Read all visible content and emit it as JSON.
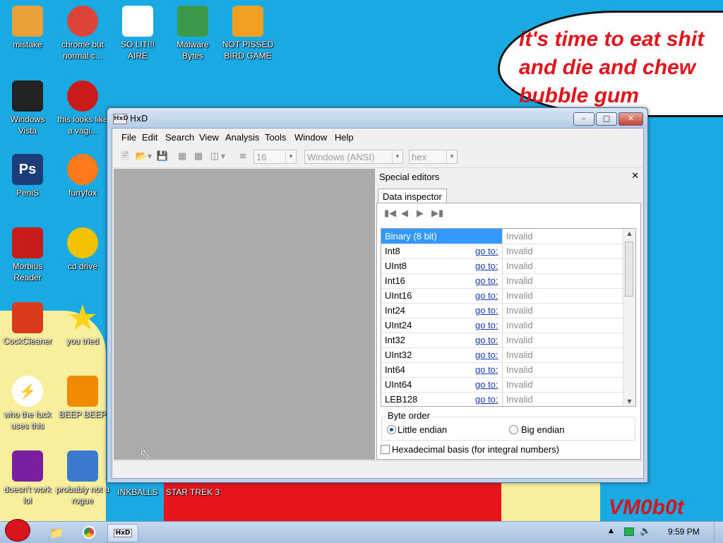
{
  "desktop": {
    "bubble_text": "it's time to eat shit\nand die and chew\nbubble gum",
    "signature": "VM0b0t",
    "icons": [
      {
        "label": "mistake",
        "icon": "folder-computer-icon",
        "color": "#e8a13a"
      },
      {
        "label": "chrome but normal c...",
        "icon": "chrome-icon",
        "color": "#db4437"
      },
      {
        "label": "SO LIT!!! AIRE",
        "icon": "solitaire-cards-icon",
        "color": "#ffffff"
      },
      {
        "label": "Malware Bytes",
        "icon": "shield-check-icon",
        "color": "#3a9a4a"
      },
      {
        "label": "NOT PISSED BIRD GAME",
        "icon": "green-pig-icon",
        "color": "#f0a020"
      },
      {
        "label": "Windows Vista",
        "icon": "trash-bin-icon",
        "color": "#222222"
      },
      {
        "label": "this looks like a vagi...",
        "icon": "opera-icon",
        "color": "#cc1b1b"
      },
      {
        "label": "PeniS",
        "icon": "photoshop-icon",
        "color": "#1c3d7a"
      },
      {
        "label": "furryfox",
        "icon": "firefox-icon",
        "color": "#ff7a1a"
      },
      {
        "label": "Morbius Reader",
        "icon": "acrobat-reader-icon",
        "color": "#c81b1b"
      },
      {
        "label": "cd drive",
        "icon": "cd-icon",
        "color": "#f2c200"
      },
      {
        "label": "CockCleaner",
        "icon": "ccleaner-icon",
        "color": "#d93a1a"
      },
      {
        "label": "you tried",
        "icon": "gold-star-icon",
        "color": "#ffd21a"
      },
      {
        "label": "who the fuck uses this",
        "icon": "lightning-icon",
        "color": "#e65a16"
      },
      {
        "label": "BEEP BEEP",
        "icon": "vlc-cone-icon",
        "color": "#f08a00"
      },
      {
        "label": "doesn't work lol",
        "icon": "yahoo-messenger-icon",
        "color": "#7a1fa0"
      },
      {
        "label": "probably not a rogue",
        "icon": "settings-monitor-icon",
        "color": "#3a7ad0"
      },
      {
        "label": "INKBALLS",
        "icon": "",
        "color": ""
      },
      {
        "label": "STAR TREK 3",
        "icon": "",
        "color": ""
      }
    ]
  },
  "window": {
    "title": "HxD",
    "menu": [
      "File",
      "Edit",
      "Search",
      "View",
      "Analysis",
      "Tools",
      "Window",
      "Help"
    ],
    "toolbar": {
      "bytes_per_row": "16",
      "charset": "Windows (ANSI)",
      "offset_base": "hex"
    },
    "special_editors": {
      "title": "Special editors",
      "tab": "Data inspector",
      "rows": [
        {
          "type": "Binary (8 bit)",
          "goto": "",
          "value": "Invalid",
          "selected": true
        },
        {
          "type": "Int8",
          "goto": "go to:",
          "value": "Invalid"
        },
        {
          "type": "UInt8",
          "goto": "go to:",
          "value": "Invalid"
        },
        {
          "type": "Int16",
          "goto": "go to:",
          "value": "Invalid"
        },
        {
          "type": "UInt16",
          "goto": "go to:",
          "value": "Invalid"
        },
        {
          "type": "Int24",
          "goto": "go to:",
          "value": "Invalid"
        },
        {
          "type": "UInt24",
          "goto": "go to:",
          "value": "Invalid"
        },
        {
          "type": "Int32",
          "goto": "go to:",
          "value": "Invalid"
        },
        {
          "type": "UInt32",
          "goto": "go to:",
          "value": "Invalid"
        },
        {
          "type": "Int64",
          "goto": "go to:",
          "value": "Invalid"
        },
        {
          "type": "UInt64",
          "goto": "go to:",
          "value": "Invalid"
        },
        {
          "type": "LEB128",
          "goto": "go to:",
          "value": "Invalid"
        }
      ],
      "byte_order_label": "Byte order",
      "little_endian": "Little endian",
      "big_endian": "Big endian",
      "byte_order_selected": "Little endian",
      "hex_basis_label": "Hexadecimal basis (for integral numbers)",
      "hex_basis_checked": false
    }
  },
  "taskbar": {
    "clock": "9:59 PM"
  }
}
